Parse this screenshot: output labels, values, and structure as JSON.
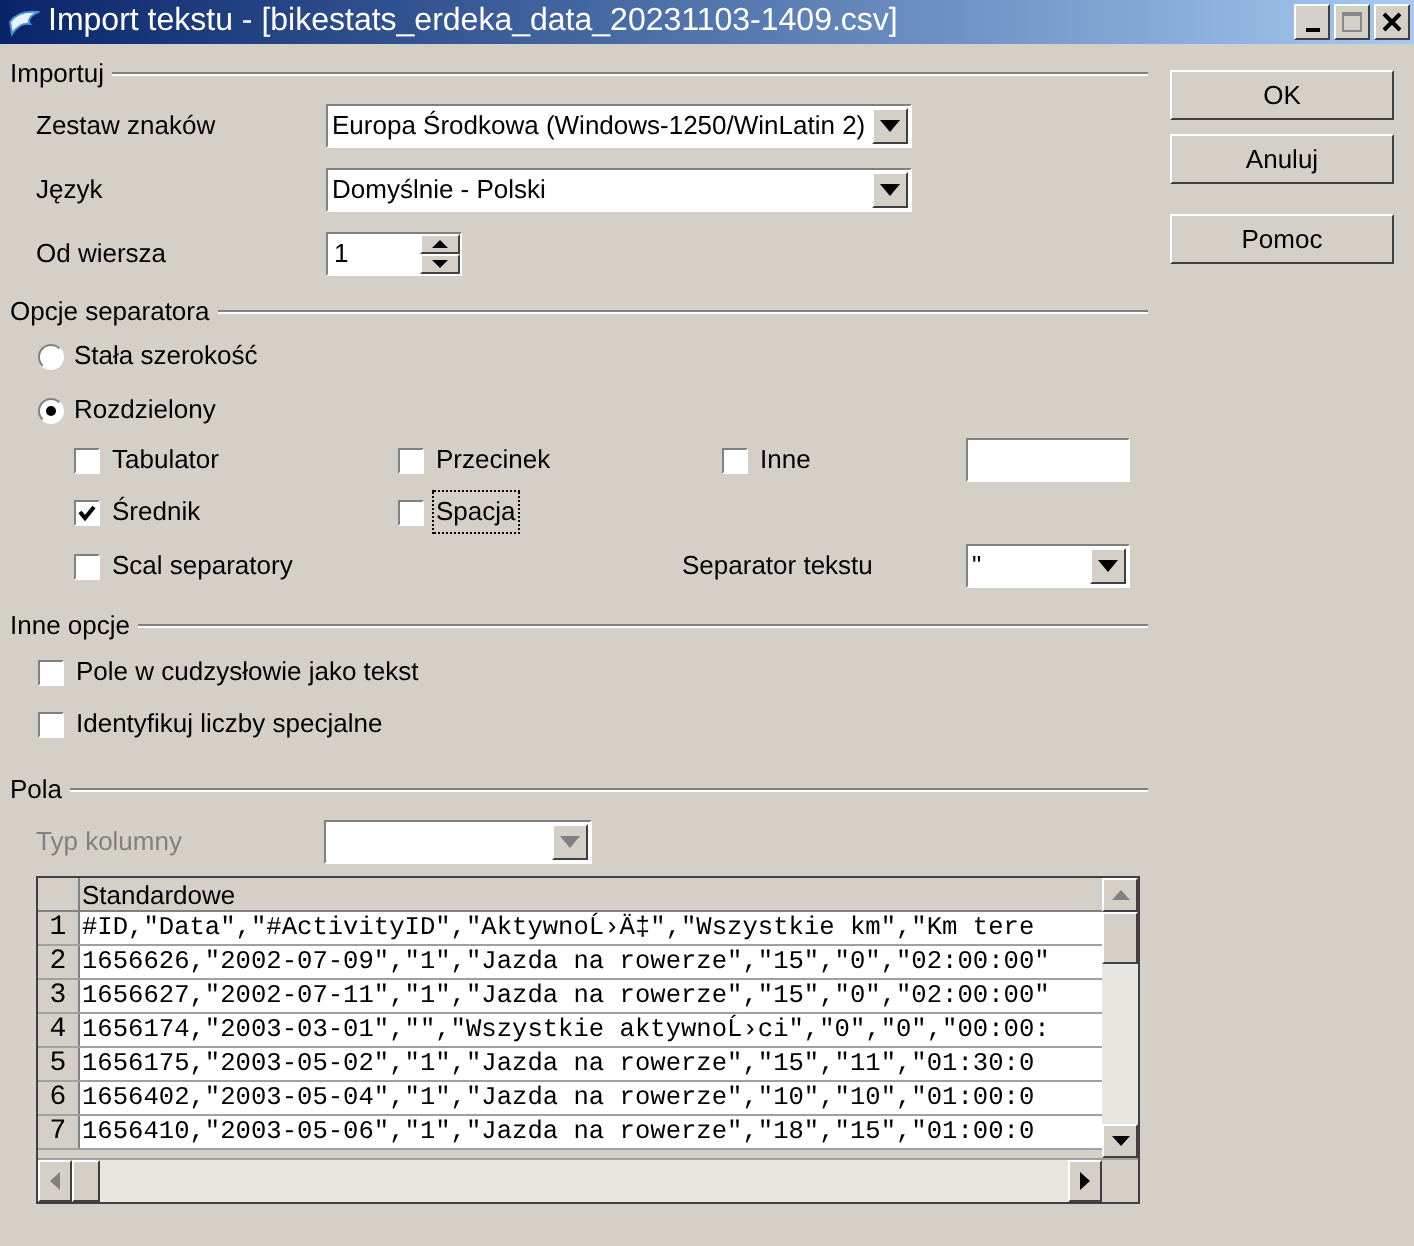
{
  "window": {
    "title": "Import tekstu - [bikestats_erdeka_data_20231103-1409.csv]"
  },
  "buttons": [
    {
      "label": "OK"
    },
    {
      "label": "Anuluj"
    },
    {
      "label": "Pomoc"
    }
  ],
  "import": {
    "title": "Importuj",
    "charset": {
      "label": "Zestaw znaków",
      "value": "Europa Środkowa (Windows-1250/WinLatin 2)"
    },
    "language": {
      "label": "Język",
      "value": "Domyślnie - Polski"
    },
    "from_row": {
      "label": "Od wiersza",
      "value": "1"
    }
  },
  "separator_options": {
    "title": "Opcje separatora",
    "modes": [
      {
        "label": "Stała szerokość",
        "selected": false
      },
      {
        "label": "Rozdzielony",
        "selected": true
      }
    ],
    "separators": [
      {
        "label": "Tabulator",
        "checked": false,
        "focused": false,
        "kind": "plain"
      },
      {
        "label": "Przecinek",
        "checked": false,
        "focused": false,
        "kind": "plain"
      },
      {
        "label": "Inne",
        "checked": false,
        "focused": false,
        "kind": "with_field"
      },
      {
        "label": "Średnik",
        "checked": true,
        "focused": false,
        "kind": "plain"
      },
      {
        "label": "Spacja",
        "checked": false,
        "focused": true,
        "kind": "plain"
      }
    ],
    "merge": {
      "label": "Scal separatory",
      "checked": false
    },
    "text_delimiter": {
      "label": "Separator tekstu",
      "value": "\""
    }
  },
  "other_options": {
    "title": "Inne opcje",
    "items": [
      {
        "label": "Pole w cudzysłowie jako tekst",
        "checked": false
      },
      {
        "label": "Identyfikuj liczby specjalne",
        "checked": false
      }
    ]
  },
  "fields": {
    "title": "Pola",
    "column_type": {
      "label": "Typ kolumny",
      "disabled": true
    },
    "table": {
      "columns": [
        "Standardowe"
      ],
      "rows": [
        {
          "number": "1",
          "text": "#ID,\"Data\",\"#ActivityID\",\"AktywnoĹ›Ä‡\",\"Wszystkie km\",\"Km tere"
        },
        {
          "number": "2",
          "text": "1656626,\"2002-07-09\",\"1\",\"Jazda na rowerze\",\"15\",\"0\",\"02:00:00\""
        },
        {
          "number": "3",
          "text": "1656627,\"2002-07-11\",\"1\",\"Jazda na rowerze\",\"15\",\"0\",\"02:00:00\""
        },
        {
          "number": "4",
          "text": "1656174,\"2003-03-01\",\"\",\"Wszystkie aktywnoĹ›ci\",\"0\",\"0\",\"00:00:"
        },
        {
          "number": "5",
          "text": "1656175,\"2003-05-02\",\"1\",\"Jazda na rowerze\",\"15\",\"11\",\"01:30:0"
        },
        {
          "number": "6",
          "text": "1656402,\"2003-05-04\",\"1\",\"Jazda na rowerze\",\"10\",\"10\",\"01:00:0"
        },
        {
          "number": "7",
          "text": "1656410,\"2003-05-06\",\"1\",\"Jazda na rowerze\",\"18\",\"15\",\"01:00:0"
        }
      ]
    }
  }
}
